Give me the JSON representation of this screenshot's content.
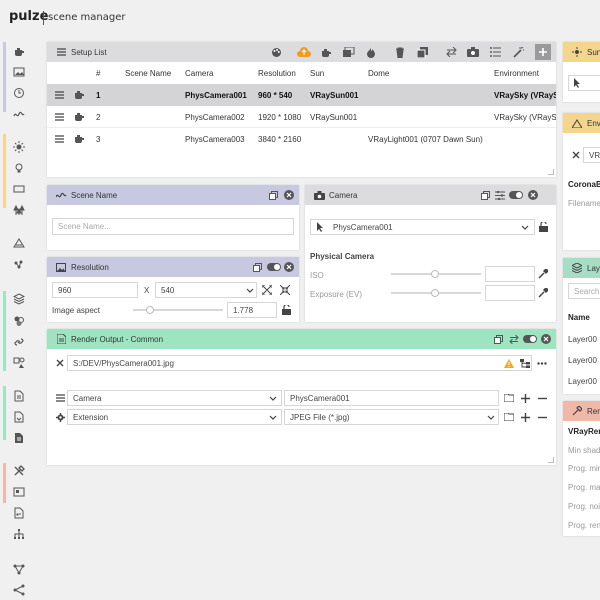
{
  "header": {
    "logo": "pulze",
    "app_title": "scene manager"
  },
  "colors": {
    "purple_header": "#c6c9df",
    "green_header": "#9fe4c1",
    "yellow_header": "#f4d58c",
    "salmon_header": "#efb8a8",
    "accent_orange": "#f29c1f",
    "warning": "#f2a81f"
  },
  "sidebar": {
    "icons": [
      "teapot-icon",
      "image-icon",
      "clock-icon",
      "wave-icon",
      "sun-icon",
      "light-bulb-icon",
      "rectangle-icon",
      "lamps-icon",
      "mountain-icon",
      "particles-icon",
      "layers-icon",
      "materials-icon",
      "link-icon",
      "scene-icon",
      "document-icon",
      "document-export-icon",
      "document-text-icon",
      "tools-icon",
      "frame-icon",
      "script-icon",
      "hierarchy-icon",
      "network-icon",
      "nodes-icon"
    ]
  },
  "setup_list": {
    "title": "Setup List",
    "columns": [
      "#",
      "Scene Name",
      "Camera",
      "Resolution",
      "Sun",
      "Dome",
      "Environment"
    ],
    "rows": [
      {
        "num": "1",
        "scene": "",
        "camera": "PhysCamera001",
        "resolution": "960 * 540",
        "sun": "VRaySun001",
        "dome": "",
        "environment": "VRaySky (VRaySky)"
      },
      {
        "num": "2",
        "scene": "",
        "camera": "PhysCamera002",
        "resolution": "1920 * 1080",
        "sun": "VRaySun001",
        "dome": "",
        "environment": "VRaySky (VRaySky)"
      },
      {
        "num": "3",
        "scene": "",
        "camera": "PhysCamera003",
        "resolution": "3840 * 2160",
        "sun": "",
        "dome": "VRayLight001 (0707 Dawn Sun)",
        "environment": ""
      }
    ]
  },
  "scene_name": {
    "title": "Scene Name",
    "placeholder": "Scene Name..."
  },
  "camera": {
    "title": "Camera",
    "selected": "PhysCamera001",
    "section": "Physical Camera",
    "iso_label": "ISO",
    "exposure_label": "Exposure (EV)"
  },
  "resolution": {
    "title": "Resolution",
    "width": "960",
    "x_sep": "X",
    "height": "540",
    "aspect_label": "Image aspect",
    "aspect_value": "1.778"
  },
  "render_output": {
    "title": "Render Output - Common",
    "path": "S:/DEV/PhysCamera001.jpg",
    "row1_type": "Camera",
    "row1_value": "PhysCamera001",
    "row2_type": "Extension",
    "row2_value": "JPEG File (*.jpg)"
  },
  "right_panels": {
    "sun_title": "Sun",
    "sun_value": "",
    "env_title": "Env",
    "env_value": "VR",
    "env_label1": "CoronaB",
    "env_label2": "Filename",
    "layers_title": "Lay",
    "layers_search": "Search",
    "layers_col": "Name",
    "layers_rows": [
      "Layer00",
      "Layer00",
      "Layer00"
    ],
    "render_title": "Rend",
    "render_label": "VRayRen",
    "render_items": [
      "Min shad",
      "Prog. min",
      "Prog. max",
      "Prog. noi",
      "Prog. ren"
    ]
  }
}
